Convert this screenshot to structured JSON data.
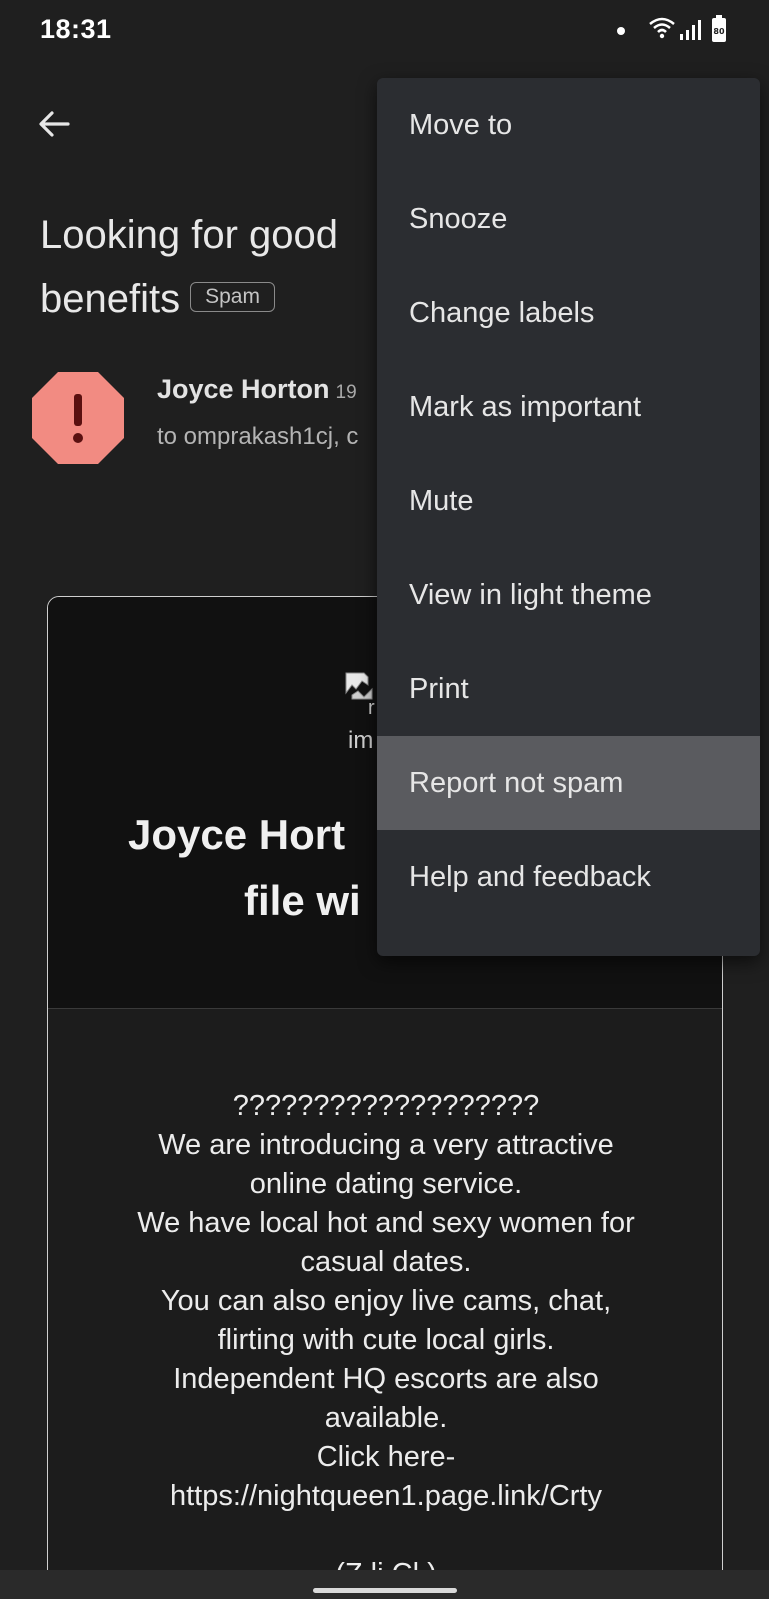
{
  "status_bar": {
    "time": "18:31",
    "icons": [
      "notification-dot-icon",
      "wifi-icon",
      "signal-icon",
      "battery-icon"
    ]
  },
  "toolbar": {
    "back_icon": "arrow-back-icon"
  },
  "email": {
    "subject": "Looking for good",
    "subject_line2": "benefits",
    "label_badge": "Spam",
    "sender_name": "Joyce Horton",
    "sender_date": "19",
    "recipient": "to omprakash1cj, c",
    "avatar_icon": "spam-warning-icon"
  },
  "body_card": {
    "image_alt_line1": "r",
    "image_alt_line2": "im",
    "title_line1": "Joyce Hort",
    "title_line2": "file wi",
    "lines": [
      "???????????????????",
      "We are introducing a very attractive",
      "online dating service.",
      "We have local hot and sexy women for",
      "casual dates.",
      "You can also enjoy live cams, chat,",
      "flirting with cute local girls.",
      "Independent HQ escorts are also",
      "available.",
      "Click here-",
      "https://nightqueen1.page.link/Crty",
      "",
      "(Z            li    Cl        )"
    ]
  },
  "menu": {
    "items": [
      "Move to",
      "Snooze",
      "Change labels",
      "Mark as important",
      "Mute",
      "View in light theme",
      "Print",
      "Report not spam",
      "Help and feedback"
    ],
    "highlighted": "Report not spam"
  },
  "colors": {
    "background": "#1f1f1f",
    "menu_bg": "#2b2d31",
    "menu_highlight": "#5a5b5f",
    "avatar_red": "#f28b82"
  }
}
